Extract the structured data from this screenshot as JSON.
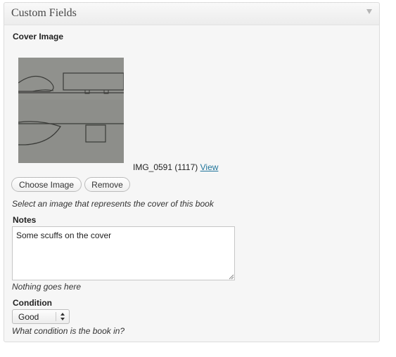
{
  "metabox": {
    "title": "Custom Fields",
    "toggle_icon": "triangle-down-icon"
  },
  "cover_image": {
    "label": "Cover Image",
    "filename": "IMG_0591 (1117)",
    "view_link": "View",
    "choose_button": "Choose Image",
    "remove_button": "Remove",
    "description": "Select an image that represents the cover of this book"
  },
  "notes": {
    "label": "Notes",
    "value": "Some scuffs on the cover",
    "description": "Nothing goes here"
  },
  "condition": {
    "label": "Condition",
    "selected": "Good",
    "description": "What condition is the book in?"
  },
  "colors": {
    "link": "#21759b",
    "panel_bg": "#f6f6f6",
    "border": "#dcdcdc"
  }
}
